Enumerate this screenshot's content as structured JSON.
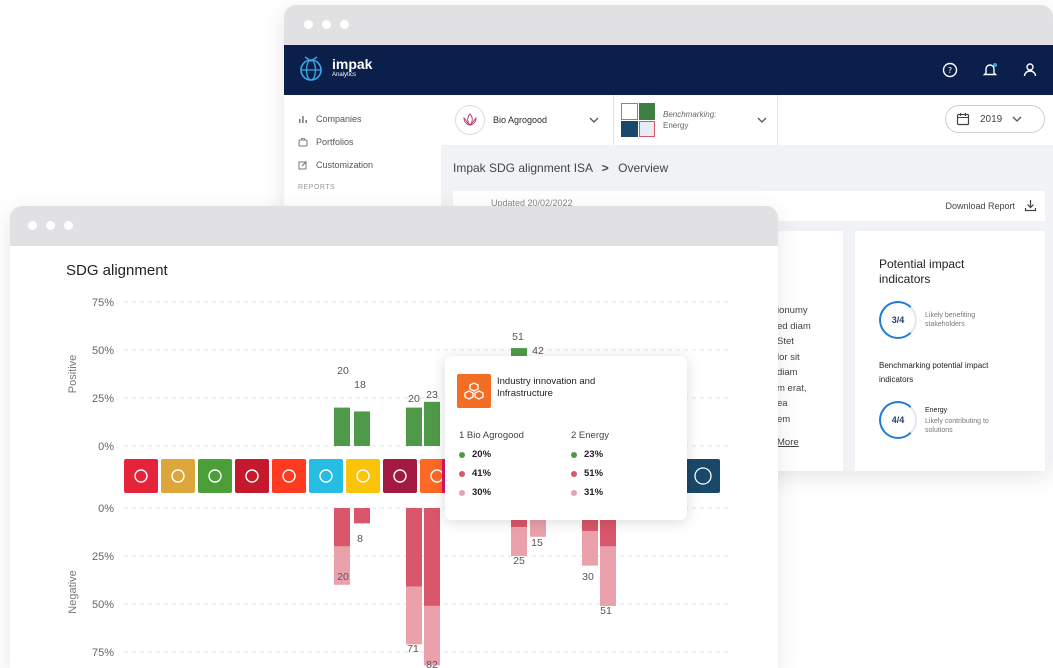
{
  "back_window": {
    "app": {
      "name": "impak",
      "sub": "Analytics"
    },
    "sidebar": {
      "items": [
        {
          "label": "Companies"
        },
        {
          "label": "Portfolios"
        },
        {
          "label": "Customization"
        }
      ],
      "section": "REPORTS"
    },
    "selector1": {
      "label": "Bio Agrogood"
    },
    "selector2": {
      "line1": "Benchmarking:",
      "line2": "Energy"
    },
    "year": "2019",
    "breadcrumb": {
      "parent": "Impak SDG alignment ISA",
      "sep": ">",
      "current": "Overview"
    },
    "updated": "Updated 20/02/2022",
    "download": "Download Report",
    "text_fragments": [
      "ionumy",
      "ed diam",
      "Stet",
      "lor sit",
      "diam",
      "m erat,",
      "ea",
      "em",
      "More"
    ],
    "potential": {
      "title": "Potential impact indicators",
      "ring1": {
        "value": "3/4",
        "text": "Likely benefiting stakeholders"
      },
      "bench_title": "Benchmarking potential impact indicators",
      "ring2": {
        "value": "4/4",
        "label": "Energy",
        "text": "Likely contributing to solutions"
      }
    }
  },
  "front_window": {
    "title": "SDG alignment",
    "positive_label": "Positive",
    "negative_label": "Negative",
    "tooltip": {
      "title": "Industry innovation and Infrastructure",
      "col1": "1 Bio Agrogood",
      "col2": "2 Energy",
      "col1_values": [
        "20%",
        "41%",
        "30%"
      ],
      "col2_values": [
        "23%",
        "51%",
        "31%"
      ]
    }
  },
  "colors": {
    "navy": "#0a1f4a",
    "green": "#4f9a48",
    "red": "#d9576a",
    "pink": "#eba1ab",
    "accent_blue": "#1f7ad8"
  },
  "chart_data": {
    "type": "bar",
    "title": "SDG alignment",
    "ylabel_positive": "Positive",
    "ylabel_negative": "Negative",
    "y_ticks_positive": [
      "75%",
      "50%",
      "25%",
      "0%"
    ],
    "y_ticks_negative": [
      "0%",
      "25%",
      "50%",
      "75%"
    ],
    "ylim": [
      -75,
      75
    ],
    "categories": [
      "SDG1",
      "SDG2",
      "SDG3",
      "SDG4",
      "SDG5",
      "SDG6",
      "SDG7",
      "SDG8",
      "SDG9",
      "SDG10",
      "SDG11",
      "SDG12",
      "SDG13",
      "SDG14",
      "SDG15",
      "SDG16",
      "SDG17"
    ],
    "sdg_colors": [
      "#e5243b",
      "#dda63a",
      "#4c9f38",
      "#c5192d",
      "#ff3a21",
      "#26bde2",
      "#fcc30b",
      "#a21942",
      "#fd6925",
      "#dd1367",
      "#fd9d24",
      "#bf8b2e",
      "#3f7e44",
      "#0a97d9",
      "#56c02b",
      "#00689d",
      "#19486a"
    ],
    "groups": [
      {
        "category": "SDG7",
        "series": [
          {
            "name": "Bio Agrogood",
            "positive": 20,
            "negative": [
              {
                "level": "dark",
                "value": 20
              },
              {
                "level": "light",
                "value": 20
              }
            ]
          },
          {
            "name": "Energy",
            "positive": 18,
            "negative": [
              {
                "level": "dark",
                "value": 8
              }
            ]
          }
        ]
      },
      {
        "category": "SDG9",
        "series": [
          {
            "name": "Bio Agrogood",
            "positive": 20,
            "negative": [
              {
                "level": "dark",
                "value": 41
              },
              {
                "level": "light",
                "value": 30
              }
            ]
          },
          {
            "name": "Energy",
            "positive": 23,
            "negative": [
              {
                "level": "dark",
                "value": 51
              },
              {
                "level": "light",
                "value": 31
              }
            ]
          }
        ]
      },
      {
        "category": "SDG12",
        "series": [
          {
            "name": "Bio Agrogood",
            "positive": 51,
            "negative": [
              {
                "level": "dark",
                "value": 10
              },
              {
                "level": "light",
                "value": 15
              }
            ]
          },
          {
            "name": "Energy",
            "positive": 42,
            "negative": [
              {
                "level": "dark",
                "value": 6
              },
              {
                "level": "light",
                "value": 9
              }
            ]
          }
        ]
      },
      {
        "category": "SDG14",
        "series": [
          {
            "name": "Bio Agrogood",
            "positive": 0,
            "negative": [
              {
                "level": "dark",
                "value": 12
              },
              {
                "level": "light",
                "value": 18
              }
            ]
          },
          {
            "name": "Energy",
            "positive": 0,
            "negative": [
              {
                "level": "dark",
                "value": 20
              },
              {
                "level": "light",
                "value": 31
              }
            ]
          }
        ]
      }
    ],
    "data_labels": [
      "20",
      "18",
      "20",
      "23",
      "51",
      "42",
      "8",
      "20",
      "15",
      "25",
      "30",
      "51",
      "71",
      "82"
    ],
    "grid": true
  }
}
